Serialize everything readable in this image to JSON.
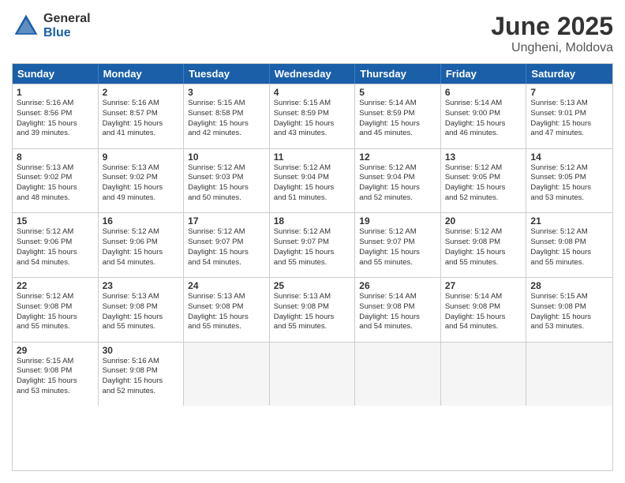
{
  "logo": {
    "general": "General",
    "blue": "Blue"
  },
  "title": "June 2025",
  "location": "Ungheni, Moldova",
  "header_days": [
    "Sunday",
    "Monday",
    "Tuesday",
    "Wednesday",
    "Thursday",
    "Friday",
    "Saturday"
  ],
  "weeks": [
    [
      {
        "day": "1",
        "sunrise": "Sunrise: 5:16 AM",
        "sunset": "Sunset: 8:56 PM",
        "daylight": "Daylight: 15 hours and 39 minutes."
      },
      {
        "day": "2",
        "sunrise": "Sunrise: 5:16 AM",
        "sunset": "Sunset: 8:57 PM",
        "daylight": "Daylight: 15 hours and 41 minutes."
      },
      {
        "day": "3",
        "sunrise": "Sunrise: 5:15 AM",
        "sunset": "Sunset: 8:58 PM",
        "daylight": "Daylight: 15 hours and 42 minutes."
      },
      {
        "day": "4",
        "sunrise": "Sunrise: 5:15 AM",
        "sunset": "Sunset: 8:59 PM",
        "daylight": "Daylight: 15 hours and 43 minutes."
      },
      {
        "day": "5",
        "sunrise": "Sunrise: 5:14 AM",
        "sunset": "Sunset: 8:59 PM",
        "daylight": "Daylight: 15 hours and 45 minutes."
      },
      {
        "day": "6",
        "sunrise": "Sunrise: 5:14 AM",
        "sunset": "Sunset: 9:00 PM",
        "daylight": "Daylight: 15 hours and 46 minutes."
      },
      {
        "day": "7",
        "sunrise": "Sunrise: 5:13 AM",
        "sunset": "Sunset: 9:01 PM",
        "daylight": "Daylight: 15 hours and 47 minutes."
      }
    ],
    [
      {
        "day": "8",
        "sunrise": "Sunrise: 5:13 AM",
        "sunset": "Sunset: 9:02 PM",
        "daylight": "Daylight: 15 hours and 48 minutes."
      },
      {
        "day": "9",
        "sunrise": "Sunrise: 5:13 AM",
        "sunset": "Sunset: 9:02 PM",
        "daylight": "Daylight: 15 hours and 49 minutes."
      },
      {
        "day": "10",
        "sunrise": "Sunrise: 5:12 AM",
        "sunset": "Sunset: 9:03 PM",
        "daylight": "Daylight: 15 hours and 50 minutes."
      },
      {
        "day": "11",
        "sunrise": "Sunrise: 5:12 AM",
        "sunset": "Sunset: 9:04 PM",
        "daylight": "Daylight: 15 hours and 51 minutes."
      },
      {
        "day": "12",
        "sunrise": "Sunrise: 5:12 AM",
        "sunset": "Sunset: 9:04 PM",
        "daylight": "Daylight: 15 hours and 52 minutes."
      },
      {
        "day": "13",
        "sunrise": "Sunrise: 5:12 AM",
        "sunset": "Sunset: 9:05 PM",
        "daylight": "Daylight: 15 hours and 52 minutes."
      },
      {
        "day": "14",
        "sunrise": "Sunrise: 5:12 AM",
        "sunset": "Sunset: 9:05 PM",
        "daylight": "Daylight: 15 hours and 53 minutes."
      }
    ],
    [
      {
        "day": "15",
        "sunrise": "Sunrise: 5:12 AM",
        "sunset": "Sunset: 9:06 PM",
        "daylight": "Daylight: 15 hours and 54 minutes."
      },
      {
        "day": "16",
        "sunrise": "Sunrise: 5:12 AM",
        "sunset": "Sunset: 9:06 PM",
        "daylight": "Daylight: 15 hours and 54 minutes."
      },
      {
        "day": "17",
        "sunrise": "Sunrise: 5:12 AM",
        "sunset": "Sunset: 9:07 PM",
        "daylight": "Daylight: 15 hours and 54 minutes."
      },
      {
        "day": "18",
        "sunrise": "Sunrise: 5:12 AM",
        "sunset": "Sunset: 9:07 PM",
        "daylight": "Daylight: 15 hours and 55 minutes."
      },
      {
        "day": "19",
        "sunrise": "Sunrise: 5:12 AM",
        "sunset": "Sunset: 9:07 PM",
        "daylight": "Daylight: 15 hours and 55 minutes."
      },
      {
        "day": "20",
        "sunrise": "Sunrise: 5:12 AM",
        "sunset": "Sunset: 9:08 PM",
        "daylight": "Daylight: 15 hours and 55 minutes."
      },
      {
        "day": "21",
        "sunrise": "Sunrise: 5:12 AM",
        "sunset": "Sunset: 9:08 PM",
        "daylight": "Daylight: 15 hours and 55 minutes."
      }
    ],
    [
      {
        "day": "22",
        "sunrise": "Sunrise: 5:12 AM",
        "sunset": "Sunset: 9:08 PM",
        "daylight": "Daylight: 15 hours and 55 minutes."
      },
      {
        "day": "23",
        "sunrise": "Sunrise: 5:13 AM",
        "sunset": "Sunset: 9:08 PM",
        "daylight": "Daylight: 15 hours and 55 minutes."
      },
      {
        "day": "24",
        "sunrise": "Sunrise: 5:13 AM",
        "sunset": "Sunset: 9:08 PM",
        "daylight": "Daylight: 15 hours and 55 minutes."
      },
      {
        "day": "25",
        "sunrise": "Sunrise: 5:13 AM",
        "sunset": "Sunset: 9:08 PM",
        "daylight": "Daylight: 15 hours and 55 minutes."
      },
      {
        "day": "26",
        "sunrise": "Sunrise: 5:14 AM",
        "sunset": "Sunset: 9:08 PM",
        "daylight": "Daylight: 15 hours and 54 minutes."
      },
      {
        "day": "27",
        "sunrise": "Sunrise: 5:14 AM",
        "sunset": "Sunset: 9:08 PM",
        "daylight": "Daylight: 15 hours and 54 minutes."
      },
      {
        "day": "28",
        "sunrise": "Sunrise: 5:15 AM",
        "sunset": "Sunset: 9:08 PM",
        "daylight": "Daylight: 15 hours and 53 minutes."
      }
    ],
    [
      {
        "day": "29",
        "sunrise": "Sunrise: 5:15 AM",
        "sunset": "Sunset: 9:08 PM",
        "daylight": "Daylight: 15 hours and 53 minutes."
      },
      {
        "day": "30",
        "sunrise": "Sunrise: 5:16 AM",
        "sunset": "Sunset: 9:08 PM",
        "daylight": "Daylight: 15 hours and 52 minutes."
      },
      {
        "day": "",
        "sunrise": "",
        "sunset": "",
        "daylight": ""
      },
      {
        "day": "",
        "sunrise": "",
        "sunset": "",
        "daylight": ""
      },
      {
        "day": "",
        "sunrise": "",
        "sunset": "",
        "daylight": ""
      },
      {
        "day": "",
        "sunrise": "",
        "sunset": "",
        "daylight": ""
      },
      {
        "day": "",
        "sunrise": "",
        "sunset": "",
        "daylight": ""
      }
    ]
  ]
}
